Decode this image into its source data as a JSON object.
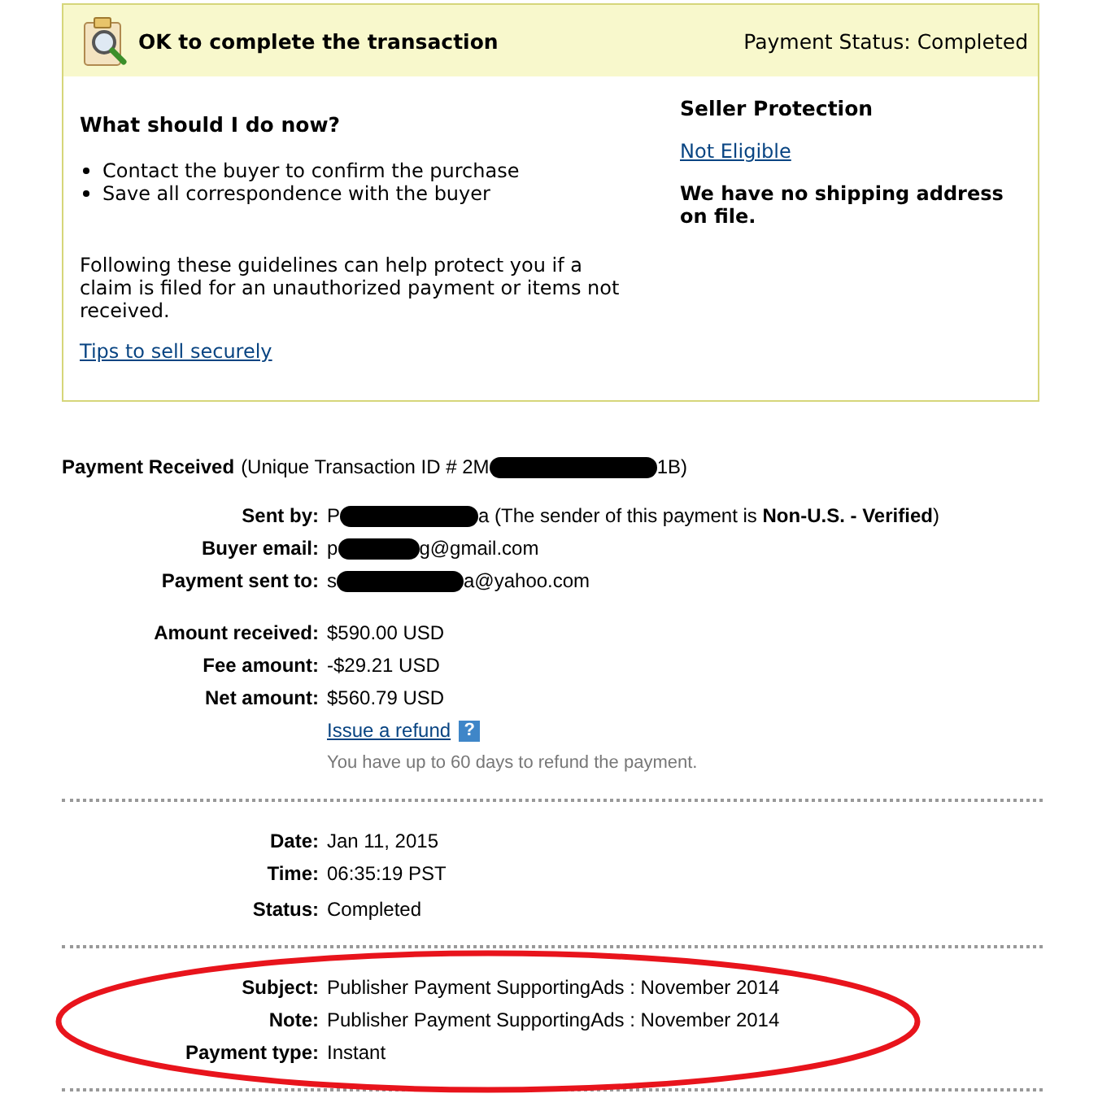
{
  "status_box": {
    "title": "OK to complete the transaction",
    "payment_status": "Payment Status: Completed",
    "heading": "What should I do now?",
    "steps": [
      "Contact the buyer to confirm the purchase",
      "Save all correspondence with the buyer"
    ],
    "guidance": "Following these guidelines can help protect you if a claim is filed for an unauthorized payment or items not received.",
    "tips_link": "Tips to sell securely",
    "protection_heading": "Seller Protection",
    "protection_link": "Not Eligible",
    "shipping_note": "We have no shipping address on file."
  },
  "payment": {
    "title": "Payment Received",
    "id_prefix": "(Unique Transaction ID # 2M",
    "id_suffix": "1B)",
    "people": [
      {
        "label": "Sent by:",
        "prefix": "P",
        "suffix": "a (The sender of this payment is **Non-U.S. - Verified**)"
      },
      {
        "label": "Buyer email:",
        "prefix": "p",
        "suffix": "g@gmail.com"
      },
      {
        "label": "Payment sent to:",
        "prefix": "s",
        "suffix": "a@yahoo.com"
      }
    ],
    "amounts": [
      {
        "label": "Amount received:",
        "value": "$590.00 USD"
      },
      {
        "label": "Fee amount:",
        "value": "-$29.21 USD"
      },
      {
        "label": "Net amount:",
        "value": "$560.79 USD"
      }
    ],
    "refund_link": "Issue a refund",
    "refund_help": "?",
    "refund_note": "You have up to 60 days to refund the payment."
  },
  "sections": [
    [
      {
        "label": "Date:",
        "value": "Jan 11, 2015"
      },
      {
        "label": "Time:",
        "value": "06:35:19 PST"
      },
      {
        "label": "Status:",
        "value": "Completed"
      }
    ],
    [
      {
        "label": "Subject:",
        "value": "Publisher Payment SupportingAds : November 2014"
      },
      {
        "label": "Note:",
        "value": "Publisher Payment SupportingAds : November 2014"
      },
      {
        "label": "Payment type:",
        "value": "Instant"
      }
    ]
  ]
}
